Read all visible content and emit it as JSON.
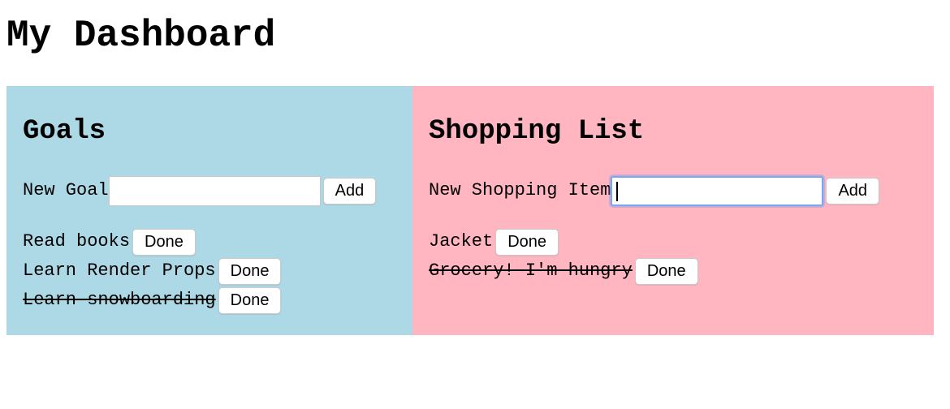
{
  "page": {
    "title": "My Dashboard"
  },
  "goals": {
    "title": "Goals",
    "form_label": "New Goal",
    "input_value": "",
    "add_label": "Add",
    "background": "#add8e6",
    "items": [
      {
        "text": "Read books",
        "completed": false,
        "done_label": "Done"
      },
      {
        "text": "Learn Render Props",
        "completed": false,
        "done_label": "Done"
      },
      {
        "text": "Learn snowboarding",
        "completed": true,
        "done_label": "Done"
      }
    ]
  },
  "shopping": {
    "title": "Shopping List",
    "form_label": "New Shopping Item",
    "input_value": "",
    "input_focused": true,
    "add_label": "Add",
    "background": "#ffb6c1",
    "items": [
      {
        "text": "Jacket",
        "completed": false,
        "done_label": "Done"
      },
      {
        "text": "Grocery! I'm hungry",
        "completed": true,
        "done_label": "Done"
      }
    ]
  }
}
